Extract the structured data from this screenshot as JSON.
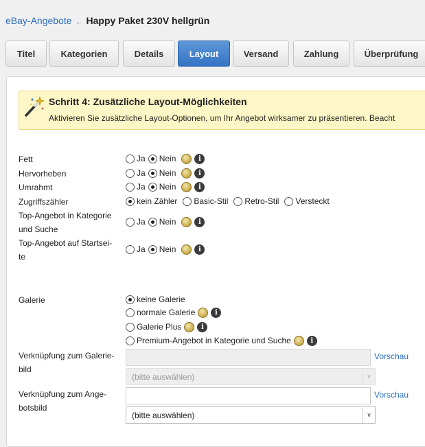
{
  "breadcrumb": {
    "link": "eBay-Angebote",
    "separator": "←",
    "title": "Happy Paket 230V hellgrün"
  },
  "tabs": [
    {
      "label": "Titel",
      "active": false
    },
    {
      "label": "Kategorien",
      "active": false
    },
    {
      "label": "Details",
      "active": false
    },
    {
      "label": "Layout",
      "active": true
    },
    {
      "label": "Versand",
      "active": false
    },
    {
      "label": "Zahlung",
      "active": false
    },
    {
      "label": "Überprüfung",
      "active": false
    }
  ],
  "info": {
    "icon": "magic-wand-icon",
    "title": "Schritt 4: Zusätzliche Layout-Möglichkeiten",
    "description": "Aktivieren Sie zusätzliche Layout-Optionen, um Ihr Angebot wirksamer zu präsentieren. Beacht"
  },
  "form": {
    "fett": {
      "label": "Fett",
      "yes": "Ja",
      "no": "Nein",
      "selected": "Nein"
    },
    "hervorheben": {
      "label": "Hervorheben",
      "yes": "Ja",
      "no": "Nein",
      "selected": "Nein"
    },
    "umrahmt": {
      "label": "Umrahmt",
      "yes": "Ja",
      "no": "Nein",
      "selected": "Nein"
    },
    "zugriffszaehler": {
      "label": "Zugriffszähler",
      "options": [
        "kein Zähler",
        "Basic-Stil",
        "Retro-Stil",
        "Versteckt"
      ],
      "selected": "kein Zähler"
    },
    "top_kategorie": {
      "label_line1": "Top-Angebot in Kategorie",
      "label_line2": "und Suche",
      "yes": "Ja",
      "no": "Nein",
      "selected": "Nein"
    },
    "top_startseite": {
      "label_line1": "Top-Angebot auf Startsei-",
      "label_line2": "te",
      "yes": "Ja",
      "no": "Nein",
      "selected": "Nein"
    },
    "galerie": {
      "label": "Galerie",
      "options": [
        "keine Galerie",
        "normale Galerie",
        "Galerie Plus",
        "Premium-Angebot in Kategorie und Suche"
      ],
      "selected": "keine Galerie"
    },
    "galerie_link": {
      "label_line1": "Verknüpfung zum Galerie-",
      "label_line2": "bild",
      "value": "",
      "preview": "Vorschau",
      "select_value": "(bitte auswählen)"
    },
    "angebot_link": {
      "label_line1": "Verknüpfung zum Ange-",
      "label_line2": "botsbild",
      "value": "",
      "preview": "Vorschau",
      "select_value": "(bitte auswählen)"
    }
  },
  "icons": {
    "fee": "fee-coin-icon",
    "info": "info-icon",
    "info_glyph": "i",
    "chevron": "∨"
  }
}
